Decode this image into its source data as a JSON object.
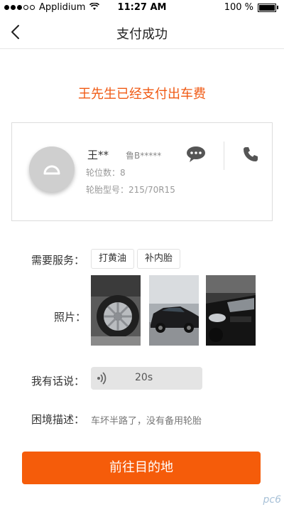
{
  "status_bar": {
    "carrier": "Applidium",
    "time": "11:27 AM",
    "battery": "100 %"
  },
  "nav": {
    "title": "支付成功"
  },
  "headline": "王先生已经支付出车费",
  "user_card": {
    "name": "王**",
    "plate": "鲁B*****",
    "seats": "轮位数：8",
    "tire": "轮胎型号：215/70R15"
  },
  "service": {
    "label": "需要服务：",
    "tags": [
      "打黄油",
      "补内胎"
    ]
  },
  "photos": {
    "label": "照片："
  },
  "voice": {
    "label": "我有话说：",
    "duration": "20s"
  },
  "description": {
    "label": "困境描述：",
    "text": "车坏半路了，没有备用轮胎"
  },
  "go_button": {
    "label": "前往目的地"
  },
  "colors": {
    "accent": "#f55c0a",
    "headline": "#f05a14"
  },
  "icons": {
    "back": "chevron-left-icon",
    "chat": "chat-bubble-icon",
    "phone": "phone-icon",
    "voice": "sound-wave-icon",
    "signal": "signal-dots-icon",
    "wifi": "wifi-icon",
    "battery": "battery-icon"
  },
  "watermark": "pc6"
}
